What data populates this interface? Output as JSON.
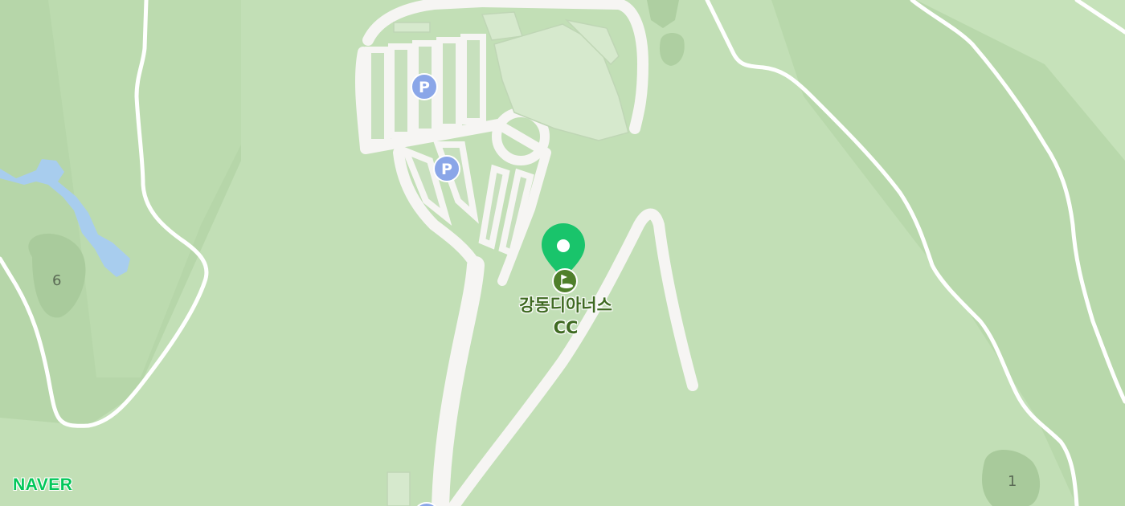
{
  "map": {
    "place": {
      "name_line1": "강동디아너스",
      "name_line2": "CC",
      "category_icon": "golf-course-icon",
      "marker_color": "#19c46b"
    },
    "hole_numbers": [
      "6",
      "1"
    ],
    "parking_icon": "parking-icon",
    "parking_label": "P",
    "parking_color": "#8aa6e8",
    "brand": "NAVER",
    "brand_color": "#03c75a"
  }
}
